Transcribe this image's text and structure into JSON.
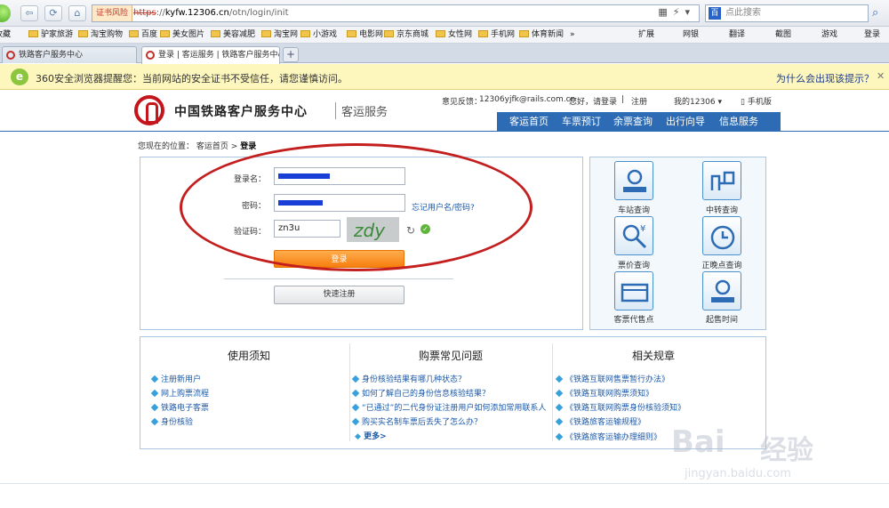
{
  "browser": {
    "address": {
      "cert_warning": "证书风险",
      "url_scheme": "https",
      "url_sep": "://",
      "url_domain": "kyfw.12306.cn",
      "url_path": "/otn/login/init",
      "search_placeholder": "点此搜索",
      "more": "»"
    },
    "bookmarks": [
      "收藏",
      "驴家旅游",
      "淘宝购物",
      "百度",
      "美女图片",
      "美容减肥",
      "淘宝网",
      "小游戏",
      "电影网",
      "京东商城",
      "女性网",
      "手机网",
      "体育新闻"
    ],
    "bookmarks_more": "»",
    "toolbar_right": [
      "扩展",
      "网银",
      "翻译",
      "截图",
      "游戏",
      "登录"
    ],
    "tabs": [
      {
        "title": "铁路客户服务中心"
      },
      {
        "title": "登录 | 客运服务 | 铁路客户服务中心"
      }
    ],
    "newtab": "+",
    "infobar": {
      "badge": "e",
      "message": "360安全浏览器提醒您：当前网站的安全证书不受信任，请您谨慎访问。",
      "why_link": "为什么会出现该提示？",
      "close": "✕"
    }
  },
  "header": {
    "site_name": "中国铁路客户服务中心",
    "site_sub": "客运服务",
    "feedback_label": "意见反馈：",
    "feedback_email": "12306yjfk@rails.com.cn",
    "greeting": "您好，请",
    "login": "登录",
    "register": "注册",
    "separator": "|",
    "my12306": "我的12306",
    "mobile": "手机版"
  },
  "nav": [
    "客运首页",
    "车票预订",
    "余票查询",
    "出行向导",
    "信息服务"
  ],
  "breadcrumb": {
    "prefix": "您现在的位置：",
    "home": "客运首页",
    "sep": ">",
    "current": "登录"
  },
  "login": {
    "username_label": "登录名：",
    "password_label": "密码：",
    "captcha_label": "验证码：",
    "captcha_value": "zn3u",
    "captcha_image_text": "zdy",
    "forgot": "忘记用户名/密码?",
    "submit": "登录",
    "quick_register": "快速注册"
  },
  "services": [
    {
      "label": "车站查询",
      "icon": "station-icon"
    },
    {
      "label": "中转查询",
      "icon": "transfer-icon"
    },
    {
      "label": "票价查询",
      "icon": "price-icon"
    },
    {
      "label": "正晚点查询",
      "icon": "clock-icon"
    },
    {
      "label": "客票代售点",
      "icon": "ticket-agency-icon"
    },
    {
      "label": "起售时间",
      "icon": "sale-time-icon"
    }
  ],
  "info": {
    "notice": {
      "title": "使用须知",
      "items": [
        "注册新用户",
        "网上购票流程",
        "铁路电子客票",
        "身份核验"
      ]
    },
    "faq": {
      "title": "购票常见问题",
      "items": [
        "身份核验结果有哪几种状态？",
        "如何了解自己的身份信息核验结果？",
        "“已通过”的二代身份证注册用户如何添加常用联系人",
        "购买实名制车票后丢失了怎么办？"
      ],
      "more": "更多>"
    },
    "rules": {
      "title": "相关规章",
      "items": [
        "《铁路互联网售票暂行办法》",
        "《铁路互联网购票须知》",
        "《铁路互联网购票身份核验须知》",
        "《铁路旅客运输规程》",
        "《铁路旅客运输办理细则》"
      ]
    }
  },
  "watermark": {
    "brand": "Bai",
    "brand2": "经验",
    "url": "jingyan.baidu.com"
  }
}
